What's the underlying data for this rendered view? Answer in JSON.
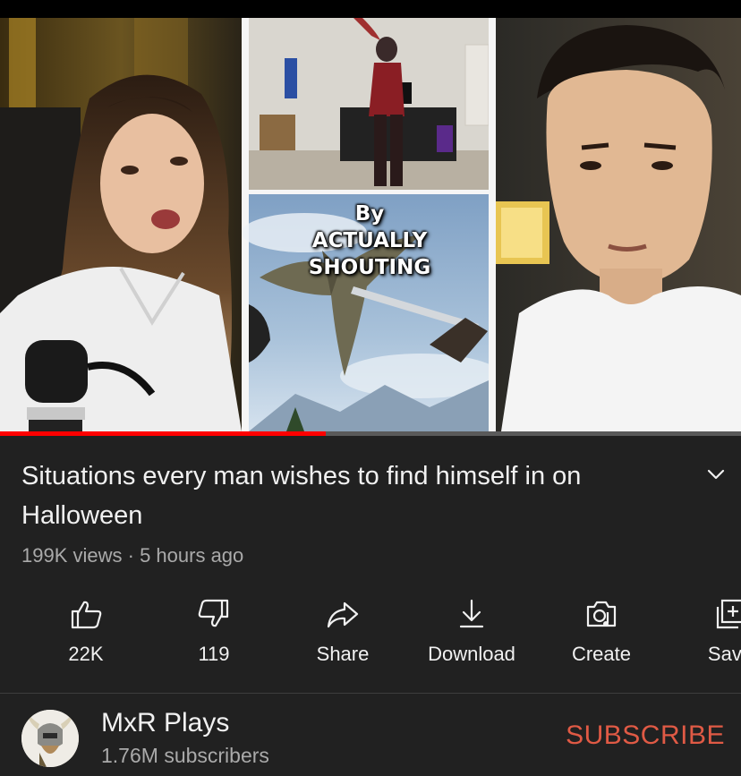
{
  "video": {
    "overlay_lines": [
      "By",
      "ACTUALLY",
      "SHOUTING"
    ],
    "progress_fraction": 0.44
  },
  "title": "Situations every man wishes to find himself in on Halloween",
  "meta": {
    "views": "199K views",
    "separator": " · ",
    "age": "5 hours ago"
  },
  "actions": [
    {
      "label": "22K",
      "icon": "thumbs-up-icon"
    },
    {
      "label": "119",
      "icon": "thumbs-down-icon"
    },
    {
      "label": "Share",
      "icon": "share-icon"
    },
    {
      "label": "Download",
      "icon": "download-icon"
    },
    {
      "label": "Create",
      "icon": "create-icon"
    },
    {
      "label": "Save",
      "icon": "save-icon"
    }
  ],
  "channel": {
    "name": "MxR Plays",
    "subscribers": "1.76M subscribers",
    "subscribe_label": "SUBSCRIBE"
  },
  "colors": {
    "background": "#212121",
    "progress": "#ff0000",
    "subscribe": "#e05a45",
    "secondary_text": "#aaaaaa"
  }
}
